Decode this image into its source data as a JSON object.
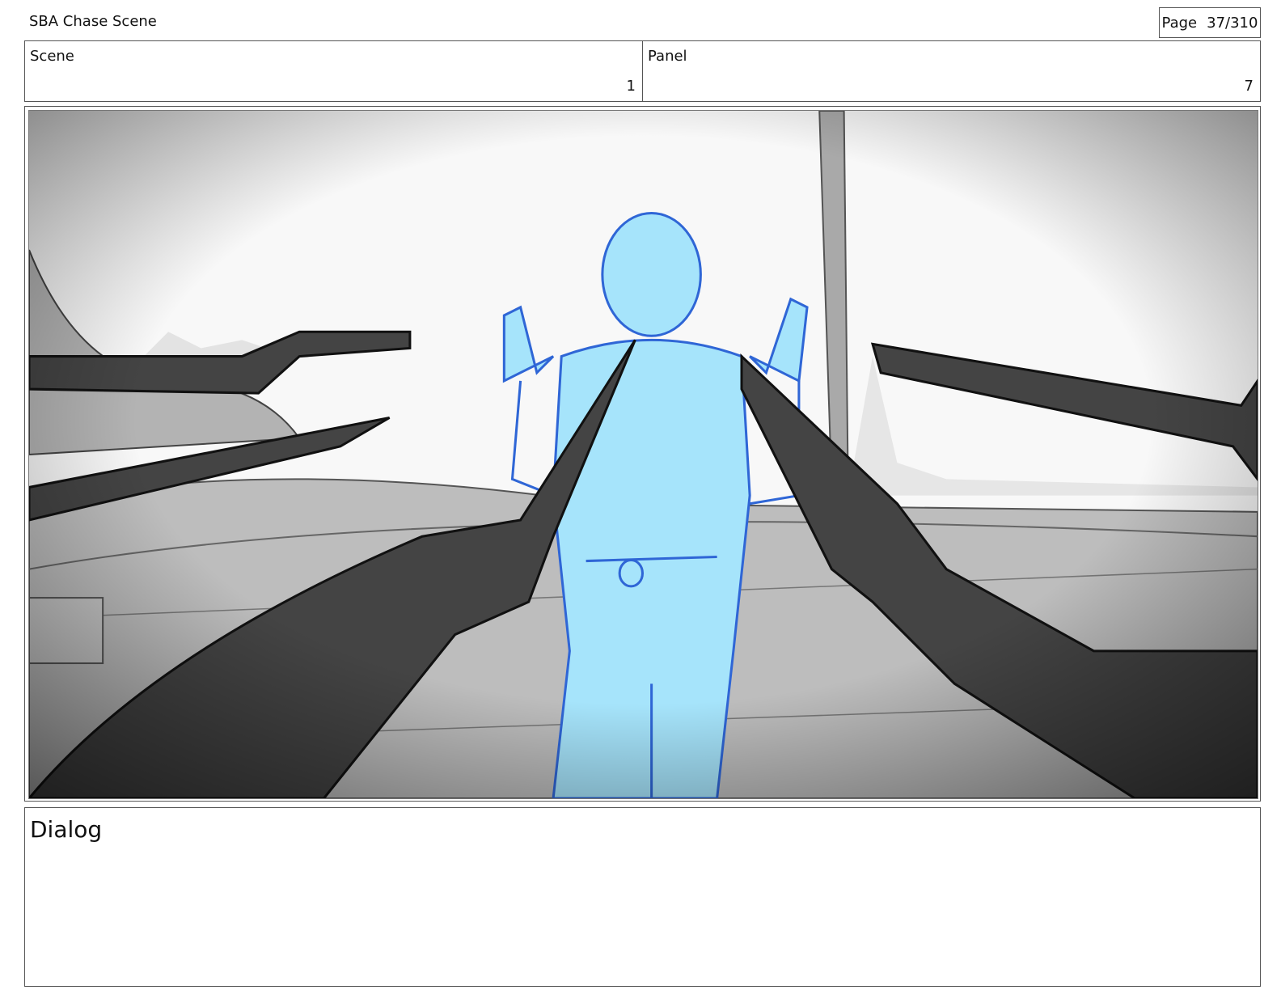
{
  "header": {
    "title": "SBA Chase Scene",
    "page_label": "Page",
    "page_value": "37/310"
  },
  "scene": {
    "label": "Scene",
    "value": "1"
  },
  "panel": {
    "label": "Panel",
    "value": "7"
  },
  "dialog": {
    "label": "Dialog",
    "text": ""
  },
  "colors": {
    "figure_fill": "#a6e4fb",
    "figure_line": "#2f66d6",
    "blades": "#444444",
    "deck": "#bdbdbd"
  }
}
